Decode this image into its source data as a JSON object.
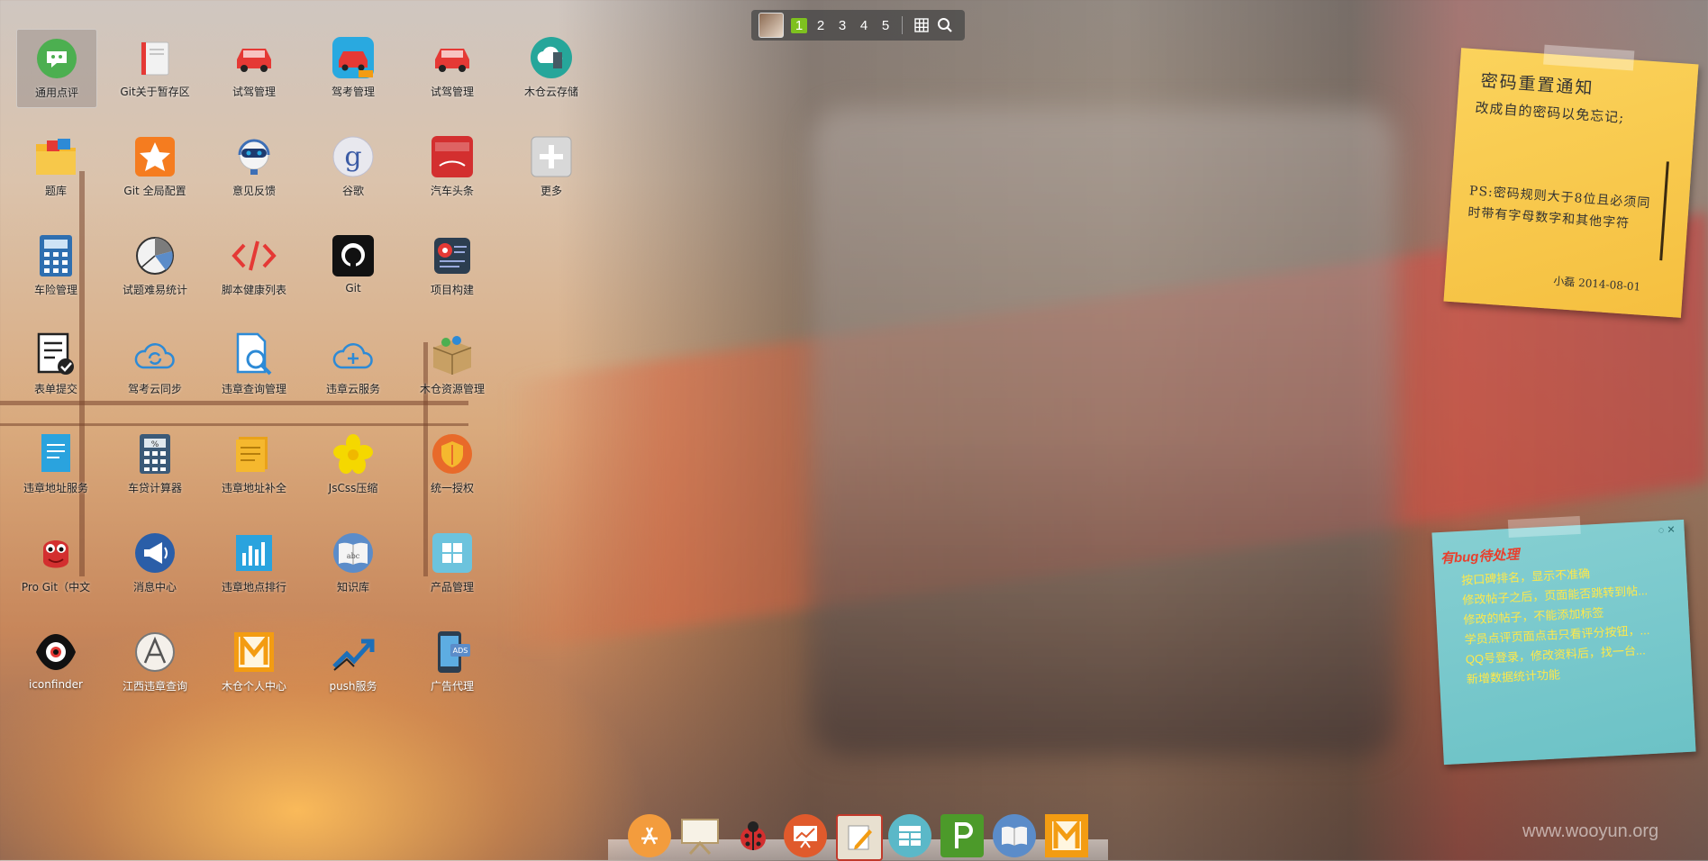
{
  "topbar": {
    "pages": [
      "1",
      "2",
      "3",
      "4",
      "5"
    ],
    "active_page": "1",
    "icons": [
      "user-avatar",
      "grid-icon",
      "search-icon"
    ]
  },
  "desktop": {
    "icons": [
      {
        "label": "通用点评",
        "icon": "chat-bubble-icon",
        "color": "#4caf50"
      },
      {
        "label": "Git关于暂存区",
        "icon": "book-icon",
        "color": "#e53935"
      },
      {
        "label": "试驾管理",
        "icon": "red-car-icon",
        "color": "#e53935"
      },
      {
        "label": "驾考管理",
        "icon": "blue-car-icon",
        "color": "#29a9e0"
      },
      {
        "label": "试驾管理",
        "icon": "red-car-icon",
        "color": "#e53935"
      },
      {
        "label": "木仓云存储",
        "icon": "cloud-server-icon",
        "color": "#26a69a"
      },
      {
        "label": "题库",
        "icon": "folder-icon",
        "color": "#f5b82e"
      },
      {
        "label": "Git 全局配置",
        "icon": "star-icon",
        "color": "#f57c1f"
      },
      {
        "label": "意见反馈",
        "icon": "headset-robot-icon",
        "color": "#3d6fb6"
      },
      {
        "label": "谷歌",
        "icon": "google-icon",
        "color": "#3b5ba5"
      },
      {
        "label": "汽车头条",
        "icon": "news-icon",
        "color": "#d32f2f"
      },
      {
        "label": "更多",
        "icon": "plus-icon",
        "color": "#cccccc"
      },
      {
        "label": "车险管理",
        "icon": "calculator-building-icon",
        "color": "#2f6fb0"
      },
      {
        "label": "试题难易统计",
        "icon": "pie-chart-icon",
        "color": "#444444"
      },
      {
        "label": "脚本健康列表",
        "icon": "code-icon",
        "color": "#e53935"
      },
      {
        "label": "Git",
        "icon": "github-icon",
        "color": "#111111"
      },
      {
        "label": "项目构建",
        "icon": "terminal-gear-icon",
        "color": "#e53935"
      },
      {
        "label": "表单提交",
        "icon": "form-check-icon",
        "color": "#222222"
      },
      {
        "label": "驾考云同步",
        "icon": "cloud-sync-icon",
        "color": "#2d8ad6"
      },
      {
        "label": "违章查询管理",
        "icon": "document-search-icon",
        "color": "#2d8ad6"
      },
      {
        "label": "违章云服务",
        "icon": "cloud-plus-icon",
        "color": "#2d8ad6"
      },
      {
        "label": "木仓资源管理",
        "icon": "box-icon",
        "color": "#c8a064"
      },
      {
        "label": "违章地址服务",
        "icon": "document-blue-icon",
        "color": "#2aa3de"
      },
      {
        "label": "车贷计算器",
        "icon": "calculator-icon",
        "color": "#3b5a78"
      },
      {
        "label": "违章地址补全",
        "icon": "notes-icon",
        "color": "#f5b82e"
      },
      {
        "label": "JsCss压缩",
        "icon": "flower-icon",
        "color": "#f5d800"
      },
      {
        "label": "统一授权",
        "icon": "shield-icon",
        "color": "#e86a2a"
      },
      {
        "label": "Pro Git（中文",
        "icon": "bug-monster-icon",
        "color": "#d32f2f"
      },
      {
        "label": "消息中心",
        "icon": "megaphone-icon",
        "color": "#2a5ea8"
      },
      {
        "label": "违章地点排行",
        "icon": "bar-chart-icon",
        "color": "#2aa3de"
      },
      {
        "label": "知识库",
        "icon": "open-book-icon",
        "color": "#5b8cc9"
      },
      {
        "label": "产品管理",
        "icon": "windows-icon",
        "color": "#6cc3dd"
      },
      {
        "label": "iconfinder",
        "icon": "eye-icon",
        "color": "#111111"
      },
      {
        "label": "江西违章查询",
        "icon": "letter-a-icon",
        "color": "#777777"
      },
      {
        "label": "木仓个人中心",
        "icon": "m-logo-icon",
        "color": "#f39c12"
      },
      {
        "label": "push服务",
        "icon": "trend-arrow-icon",
        "color": "#1d6fb8"
      },
      {
        "label": "广告代理",
        "icon": "phone-ads-icon",
        "color": "#2c3e50"
      }
    ]
  },
  "note_yellow": {
    "title": "密码重置通知",
    "line1": "改成自的密码以免忘记;",
    "ps": "PS:密码规则大于8位且必须同时带有字母数字和其他字符",
    "signature": "小磊  2014-08-01",
    "color": "#f8c84a"
  },
  "note_blue": {
    "title": "有bug待处理",
    "controls": "◌ ✕",
    "items": [
      "按口碑排名，显示不准确",
      "修改帖子之后，页面能否跳转到帖...",
      "修改的帖子，不能添加标签",
      "学员点评页面点击只看评分按钮，...",
      "QQ号登录，修改资料后，找一台...",
      "新增数据统计功能"
    ],
    "color": "#7ccacd",
    "text_color": "#ffe94a",
    "title_color": "#e8402e"
  },
  "dock": {
    "items": [
      {
        "name": "app-store-icon",
        "color": "#f39c3d"
      },
      {
        "name": "presentation-board-icon",
        "color": "#d9c9a8"
      },
      {
        "name": "ladybug-icon",
        "color": "#d32f2f"
      },
      {
        "name": "chart-board-icon",
        "color": "#e05a2c"
      },
      {
        "name": "notepad-pen-icon",
        "color": "#e8e0d0"
      },
      {
        "name": "database-grid-icon",
        "color": "#5bb8c8"
      },
      {
        "name": "letter-p-icon",
        "color": "#4c9a2a"
      },
      {
        "name": "open-book-icon",
        "color": "#5b8cc9"
      },
      {
        "name": "m-logo-icon",
        "color": "#f39c12"
      }
    ]
  },
  "watermark": "www.wooyun.org"
}
